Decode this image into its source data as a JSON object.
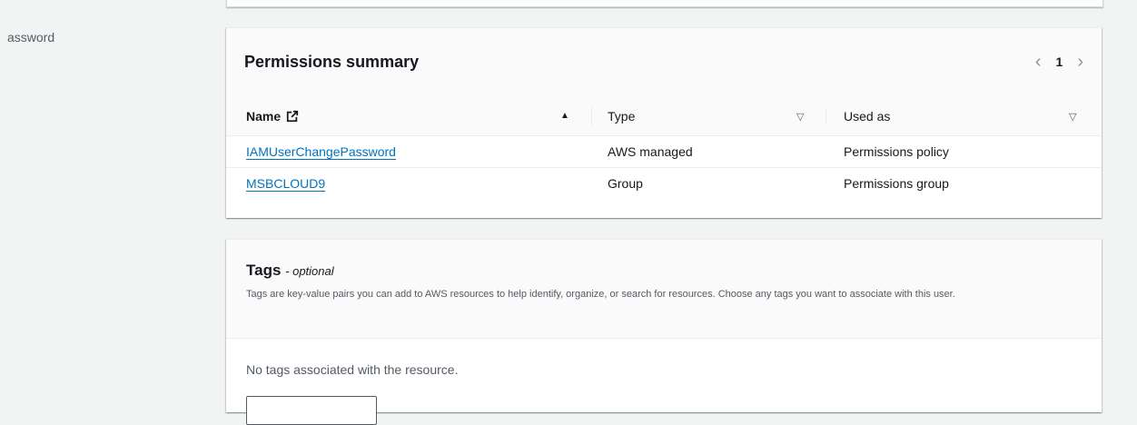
{
  "left_label": "assword",
  "permissions": {
    "title": "Permissions summary",
    "pager": {
      "prev": "‹",
      "page": "1",
      "next": "›"
    },
    "columns": [
      {
        "label": "Name"
      },
      {
        "label": "Type"
      },
      {
        "label": "Used as"
      }
    ],
    "rows": [
      {
        "name": "IAMUserChangePassword",
        "type": "AWS managed",
        "used_as": "Permissions policy"
      },
      {
        "name": "MSBCLOUD9",
        "type": "Group",
        "used_as": "Permissions group"
      }
    ],
    "sort_icons": {
      "name": "▲",
      "type": "▽",
      "used": "▽"
    }
  },
  "tags": {
    "title": "Tags",
    "optional": "- optional",
    "description": "Tags are key-value pairs you can add to AWS resources to help identify, organize, or search for resources. Choose any tags you want to associate with this user.",
    "empty_text": "No tags associated with the resource."
  },
  "colors": {
    "link": "#0073bb",
    "background": "#f2f3f3"
  }
}
